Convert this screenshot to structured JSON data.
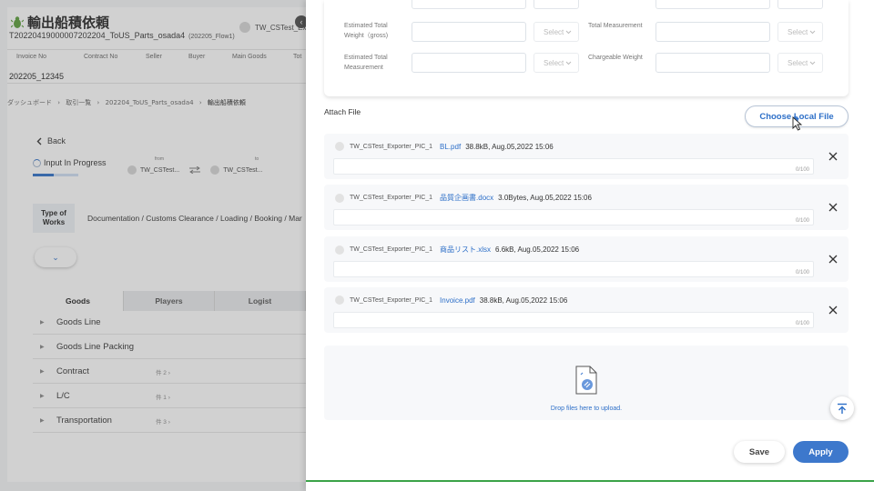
{
  "background_page": {
    "title": "輸出船積依頼",
    "subtitle": "T20220419000007202204_ToUS_Parts_osada4",
    "subtitle_small": "(202205_Flow1)",
    "user_chip": "TW_CSTest_Ex",
    "collapse_glyph": "‹",
    "info_columns": [
      "Invoice No",
      "Contract No",
      "Seller",
      "Buyer",
      "Main Goods",
      "Tot"
    ],
    "invoice_value": "202205_12345",
    "breadcrumb": {
      "item1": "ダッシュボード",
      "item2": "取引一覧",
      "item3": "202204_ToUS_Parts_osada4",
      "current": "輸出船積依頼",
      "separator": "›"
    },
    "back_label": "Back",
    "status_label": "Input In Progress",
    "status_progress": 0.45,
    "from_label": "from",
    "from_value": "TW_CSTest...",
    "to_label": "to",
    "to_value": "TW_CSTest...",
    "type_of_works_label": "Type of Works",
    "type_of_works_value": "Documentation / Customs Clearance / Loading / Booking / Mar",
    "expand_glyph": "⌄",
    "tabs": [
      "Goods",
      "Players",
      "Logist"
    ],
    "accordion": [
      {
        "label": "Goods Line",
        "count": ""
      },
      {
        "label": "Goods Line Packing",
        "count": ""
      },
      {
        "label": "Contract",
        "count": "件 2 ›"
      },
      {
        "label": "L/C",
        "count": "件 1 ›"
      },
      {
        "label": "Transportation",
        "count": "件 3 ›"
      }
    ]
  },
  "panel": {
    "fields": {
      "total_weight_label": "Estimated Total Weight（gross)",
      "total_measurement_label": "Total Measurement",
      "est_total_measurement_label": "Estimated Total Measurement",
      "chargeable_weight_label": "Chargeable Weight",
      "select_placeholder": "Select"
    },
    "attach_file_label": "Attach File",
    "choose_file_button": "Choose Local File",
    "files": [
      {
        "uploader": "TW_CSTest_Exporter_PIC_1",
        "name": "BL.pdf",
        "info": "38.8kB, Aug.05,2022 15:06",
        "count": "0/100"
      },
      {
        "uploader": "TW_CSTest_Exporter_PIC_1",
        "name": "品質企画書.docx",
        "info": "3.0Bytes, Aug.05,2022 15:06",
        "count": "0/100"
      },
      {
        "uploader": "TW_CSTest_Exporter_PIC_1",
        "name": "商品リスト.xlsx",
        "info": "6.6kB, Aug.05,2022 15:06",
        "count": "0/100"
      },
      {
        "uploader": "TW_CSTest_Exporter_PIC_1",
        "name": "Invoice.pdf",
        "info": "38.8kB, Aug.05,2022 15:06",
        "count": "0/100"
      }
    ],
    "dropzone_text": "Drop files here to upload.",
    "save_button": "Save",
    "apply_button": "Apply"
  },
  "colors": {
    "accent": "#2d6fc8",
    "apply": "#3d78cc",
    "status_bar": "#3aa348"
  }
}
